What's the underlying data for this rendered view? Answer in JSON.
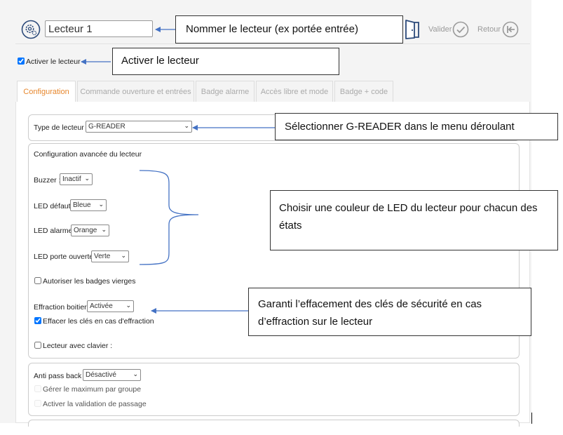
{
  "header": {
    "reader_name_value": "Lecteur 1",
    "validate_label": "Valider",
    "back_label": "Retour"
  },
  "activate_reader": {
    "label": "Activer le lecteur",
    "checked": true
  },
  "tabs": [
    {
      "label": "Configuration",
      "active": true
    },
    {
      "label": "Commande ouverture et entrées",
      "active": false
    },
    {
      "label": "Badge alarme",
      "active": false
    },
    {
      "label": "Accès libre et mode",
      "active": false
    },
    {
      "label": "Badge + code",
      "active": false
    }
  ],
  "config": {
    "reader_type_label": "Type de lecteur :",
    "reader_type_value": "G-READER",
    "advanced_title": "Configuration avancée du lecteur",
    "buzzer_label": "Buzzer :",
    "buzzer_value": "Inactif",
    "led_default_label": "LED défaut",
    "led_default_value": "Bleue",
    "led_alarm_label": "LED alarme",
    "led_alarm_value": "Orange",
    "led_door_label": "LED porte ouverte",
    "led_door_value": "Verte",
    "blank_badges_label": "Autoriser les badges vierges",
    "blank_badges_checked": false,
    "tamper_label": "Effraction boitier",
    "tamper_value": "Activée",
    "erase_keys_label": "Effacer les clés en cas d'effraction",
    "erase_keys_checked": true,
    "keypad_label": "Lecteur avec clavier :",
    "keypad_checked": false,
    "anti_passback_label": "Anti pass back :",
    "anti_passback_value": "Désactivé",
    "max_group_label": "Gérer le maximum par groupe",
    "validation_label": "Activer la validation de passage"
  },
  "callouts": {
    "name": "Nommer le lecteur (ex portée entrée)",
    "activate": "Activer le lecteur",
    "reader_type": "Sélectionner G-READER dans le menu déroulant",
    "led": "Choisir une couleur de LED du lecteur pour chacun des états",
    "tamper": "Garanti l’effacement des clés de sécurité en cas d’effraction sur le lecteur"
  },
  "colors": {
    "accent_orange": "#e7872d",
    "icon_navy": "#2c4a7a",
    "arrow_blue": "#4472c4"
  }
}
